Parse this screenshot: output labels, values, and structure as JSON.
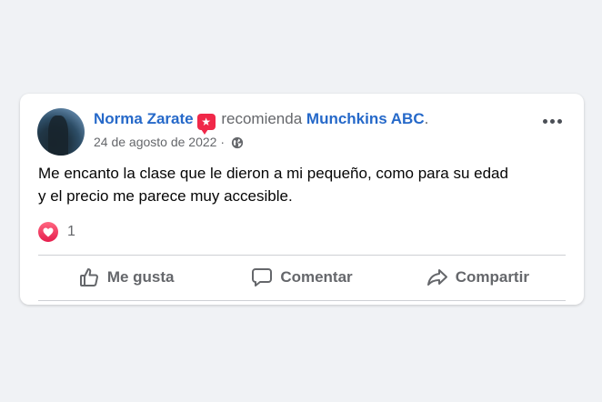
{
  "post": {
    "author": "Norma Zarate",
    "badge_icon": "recommendation-star-icon",
    "verb": "recomienda",
    "page": "Munchkins ABC",
    "period": ".",
    "date": "24 de agosto de 2022",
    "separator": "·",
    "privacy_icon": "globe-icon",
    "text": "Me encanto la clase que le dieron a mi pequeño,  como para su edad\ny el precio me parece muy accesible."
  },
  "reactions": {
    "icon": "heart-icon",
    "count": "1"
  },
  "actions": {
    "like": "Me gusta",
    "comment": "Comentar",
    "share": "Compartir"
  },
  "colors": {
    "link": "#2669c9",
    "muted": "#65676b",
    "badge": "#f02849",
    "background": "#f0f2f5"
  }
}
